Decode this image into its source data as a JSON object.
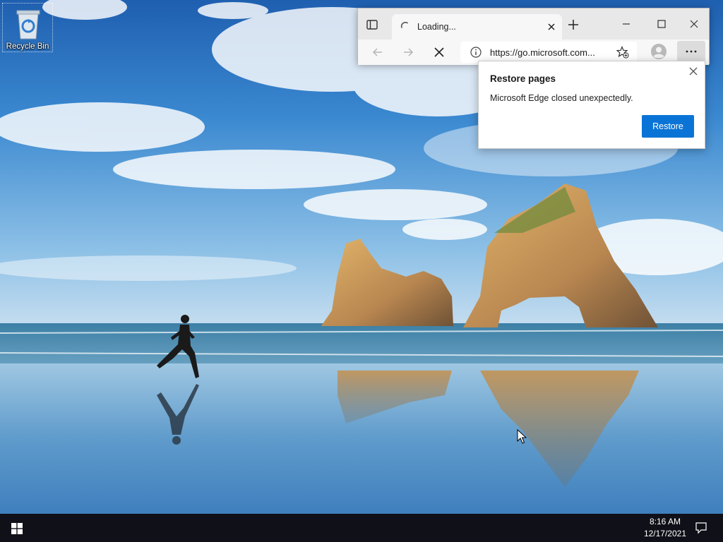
{
  "desktop": {
    "icons": [
      {
        "label": "Recycle Bin",
        "icon": "recycle-bin-icon"
      }
    ]
  },
  "browser": {
    "tab": {
      "title": "Loading...",
      "state": "loading"
    },
    "address_bar": {
      "url": "https://go.microsoft.com..."
    }
  },
  "restore_popup": {
    "title": "Restore pages",
    "message": "Microsoft Edge closed unexpectedly.",
    "button_label": "Restore"
  },
  "taskbar": {
    "time": "8:16 AM",
    "date": "12/17/2021"
  },
  "colors": {
    "accent": "#0a74d6",
    "taskbar": "#101018",
    "tab_strip": "#e8e8e8"
  }
}
